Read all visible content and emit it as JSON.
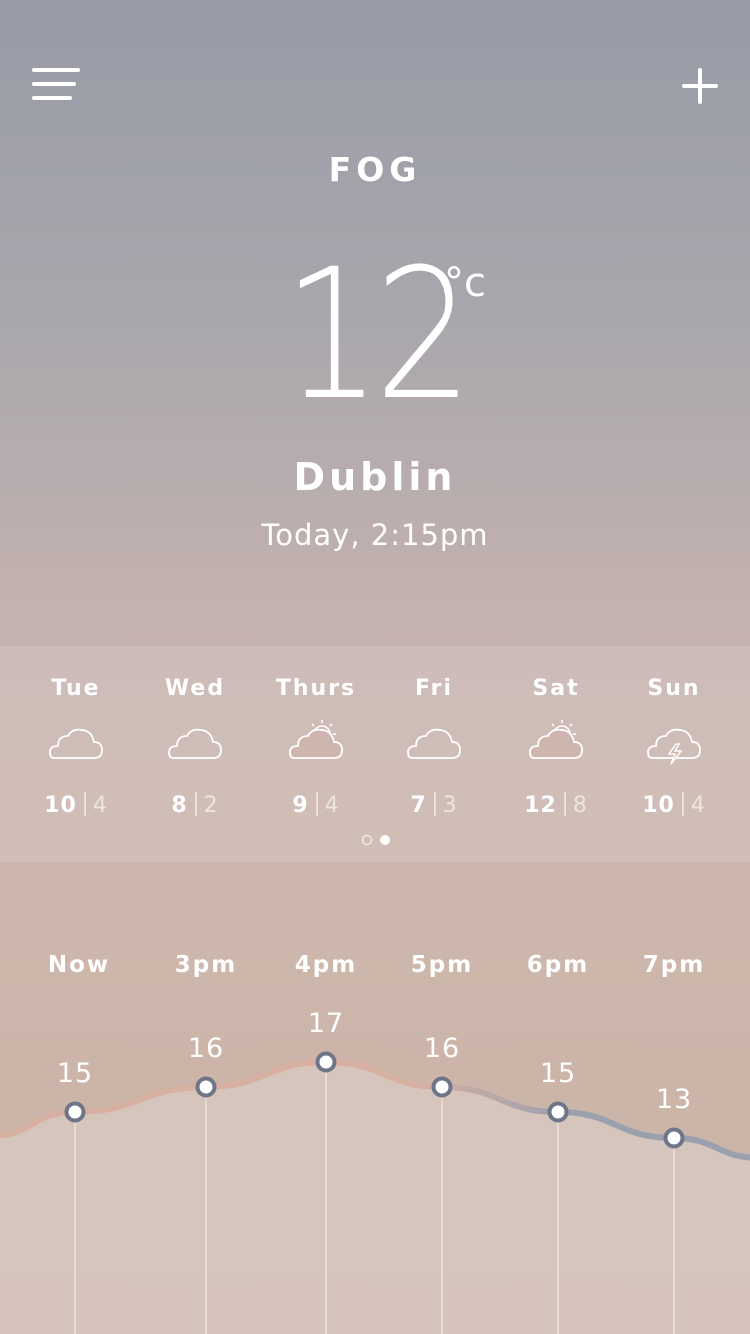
{
  "header": {
    "menu_icon": "hamburger-menu-icon",
    "add_icon": "plus-icon"
  },
  "current": {
    "condition": "FOG",
    "temperature": "12",
    "unit": "°c",
    "city": "Dublin",
    "timestamp": "Today, 2:15pm"
  },
  "forecast": [
    {
      "day": "Tue",
      "icon": "cloud-icon",
      "high": "10",
      "low": "4"
    },
    {
      "day": "Wed",
      "icon": "cloud-icon",
      "high": "8",
      "low": "2"
    },
    {
      "day": "Thurs",
      "icon": "partly-sunny-icon",
      "high": "9",
      "low": "4"
    },
    {
      "day": "Fri",
      "icon": "cloud-icon",
      "high": "7",
      "low": "3"
    },
    {
      "day": "Sat",
      "icon": "partly-sunny-icon",
      "high": "12",
      "low": "8"
    },
    {
      "day": "Sun",
      "icon": "thunderstorm-icon",
      "high": "10",
      "low": "4"
    }
  ],
  "pager": {
    "pages": 2,
    "active": 2
  },
  "hourly": {
    "labels": [
      "Now",
      "3pm",
      "4pm",
      "5pm",
      "6pm",
      "7pm"
    ],
    "values": [
      "15",
      "16",
      "17",
      "16",
      "15",
      "13"
    ]
  },
  "chart_data": {
    "type": "area",
    "categories": [
      "Now",
      "3pm",
      "4pm",
      "5pm",
      "6pm",
      "7pm"
    ],
    "values": [
      15,
      16,
      17,
      16,
      15,
      13
    ]
  },
  "colors": {
    "point_stroke": "#6f7588",
    "line_warm": "#d8b0a2",
    "line_cool": "#9aa0ae",
    "area_fill": "#d8c8c0"
  }
}
